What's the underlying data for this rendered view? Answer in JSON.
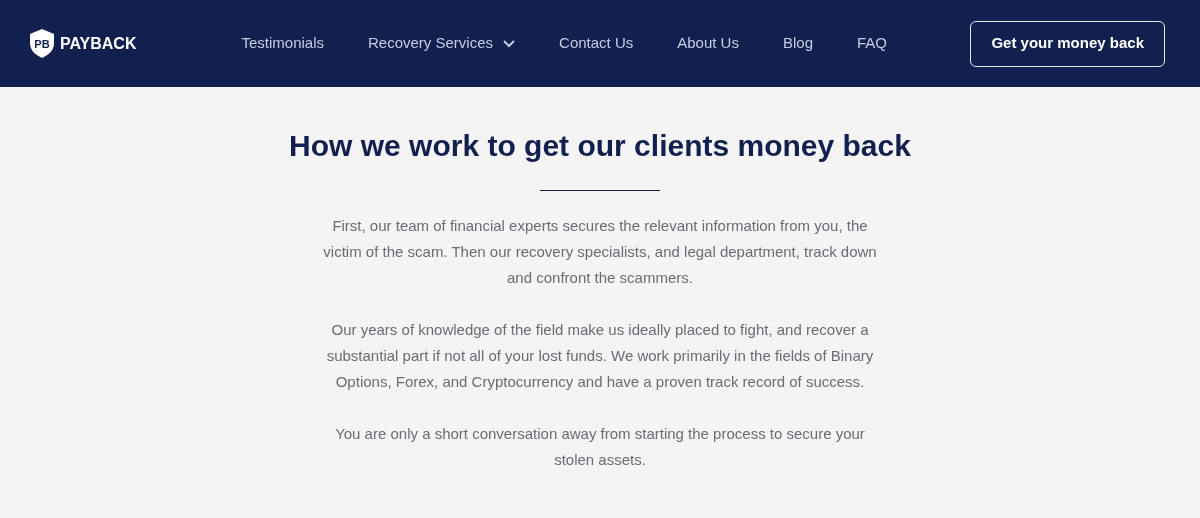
{
  "logo": {
    "mark": "PB",
    "name": "PAYBACK"
  },
  "nav": [
    {
      "label": "Testimonials",
      "kind": "link"
    },
    {
      "label": "Recovery Services",
      "kind": "dropdown"
    },
    {
      "label": "Contact Us",
      "kind": "link"
    },
    {
      "label": "About Us",
      "kind": "link"
    },
    {
      "label": "Blog",
      "kind": "link"
    },
    {
      "label": "FAQ",
      "kind": "link"
    }
  ],
  "cta": "Get your money back",
  "section": {
    "title": "How we work to get our clients money back",
    "paragraphs": [
      "First, our team of financial experts secures the relevant information from you, the victim of the scam. Then our recovery specialists, and legal department, track down and confront the scammers.",
      "Our years of knowledge of the field make us ideally placed to fight, and recover a substantial part if not all of your lost funds. We work primarily in the fields of Binary Options, Forex, and Cryptocurrency and have a proven track record of success.",
      "You are only a short conversation away from starting the process to secure your stolen assets."
    ]
  }
}
